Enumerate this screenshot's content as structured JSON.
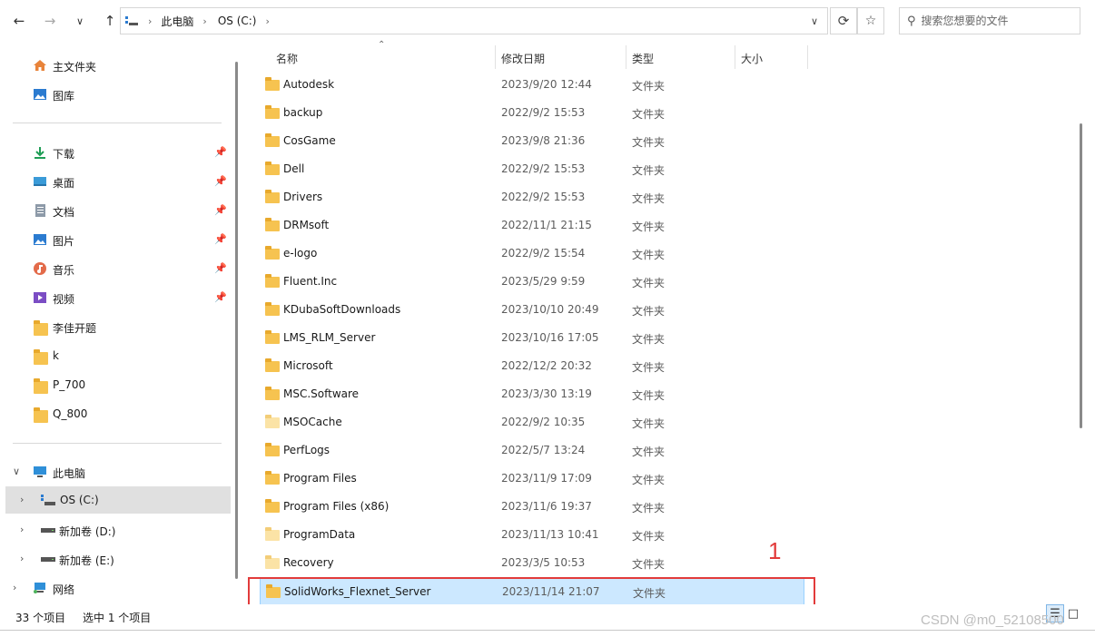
{
  "nav": {
    "back_icon": "back-arrow-icon",
    "forward_icon": "forward-arrow-icon",
    "recent_icon": "chevron-down-icon",
    "up_icon": "up-arrow-icon"
  },
  "address": {
    "crumbs": [
      "此电脑",
      "OS (C:)"
    ]
  },
  "search": {
    "placeholder": "搜索您想要的文件"
  },
  "sidebar": {
    "quick": [
      {
        "label": "主文件夹",
        "icon": "home-icon"
      },
      {
        "label": "图库",
        "icon": "gallery-icon"
      }
    ],
    "pinned": [
      {
        "label": "下载",
        "icon": "download-icon"
      },
      {
        "label": "桌面",
        "icon": "desktop-icon"
      },
      {
        "label": "文档",
        "icon": "document-icon"
      },
      {
        "label": "图片",
        "icon": "pictures-icon"
      },
      {
        "label": "音乐",
        "icon": "music-icon"
      },
      {
        "label": "视频",
        "icon": "video-icon"
      },
      {
        "label": "李佳开题",
        "icon": "folder-icon"
      },
      {
        "label": "k",
        "icon": "folder-icon"
      },
      {
        "label": "P_700",
        "icon": "folder-icon"
      },
      {
        "label": "Q_800",
        "icon": "folder-icon"
      }
    ],
    "tree": [
      {
        "label": "此电脑",
        "icon": "computer-icon"
      },
      {
        "label": "OS (C:)",
        "icon": "drive-c-icon"
      },
      {
        "label": "新加卷 (D:)",
        "icon": "drive-icon"
      },
      {
        "label": "新加卷 (E:)",
        "icon": "drive-icon"
      },
      {
        "label": "网络",
        "icon": "network-icon"
      }
    ]
  },
  "columns": {
    "name": "名称",
    "date": "修改日期",
    "type": "类型",
    "size": "大小"
  },
  "files": [
    {
      "name": "Autodesk",
      "date": "2023/9/20 12:44",
      "type": "文件夹"
    },
    {
      "name": "backup",
      "date": "2022/9/2 15:53",
      "type": "文件夹"
    },
    {
      "name": "CosGame",
      "date": "2023/9/8 21:36",
      "type": "文件夹"
    },
    {
      "name": "Dell",
      "date": "2022/9/2 15:53",
      "type": "文件夹"
    },
    {
      "name": "Drivers",
      "date": "2022/9/2 15:53",
      "type": "文件夹"
    },
    {
      "name": "DRMsoft",
      "date": "2022/11/1 21:15",
      "type": "文件夹"
    },
    {
      "name": "e-logo",
      "date": "2022/9/2 15:54",
      "type": "文件夹"
    },
    {
      "name": "Fluent.Inc",
      "date": "2023/5/29 9:59",
      "type": "文件夹"
    },
    {
      "name": "KDubaSoftDownloads",
      "date": "2023/10/10 20:49",
      "type": "文件夹"
    },
    {
      "name": "LMS_RLM_Server",
      "date": "2023/10/16 17:05",
      "type": "文件夹"
    },
    {
      "name": "Microsoft",
      "date": "2022/12/2 20:32",
      "type": "文件夹"
    },
    {
      "name": "MSC.Software",
      "date": "2023/3/30 13:19",
      "type": "文件夹"
    },
    {
      "name": "MSOCache",
      "date": "2022/9/2 10:35",
      "type": "文件夹"
    },
    {
      "name": "PerfLogs",
      "date": "2022/5/7 13:24",
      "type": "文件夹"
    },
    {
      "name": "Program Files",
      "date": "2023/11/9 17:09",
      "type": "文件夹"
    },
    {
      "name": "Program Files (x86)",
      "date": "2023/11/6 19:37",
      "type": "文件夹"
    },
    {
      "name": "ProgramData",
      "date": "2023/11/13 10:41",
      "type": "文件夹"
    },
    {
      "name": "Recovery",
      "date": "2023/3/5 10:53",
      "type": "文件夹"
    },
    {
      "name": "SolidWorks_Flexnet_Server",
      "date": "2023/11/14 21:07",
      "type": "文件夹"
    }
  ],
  "annotation": "1",
  "status": {
    "count": "33 个项目",
    "selected": "选中 1 个项目"
  },
  "watermark": "CSDN @m0_52108500"
}
